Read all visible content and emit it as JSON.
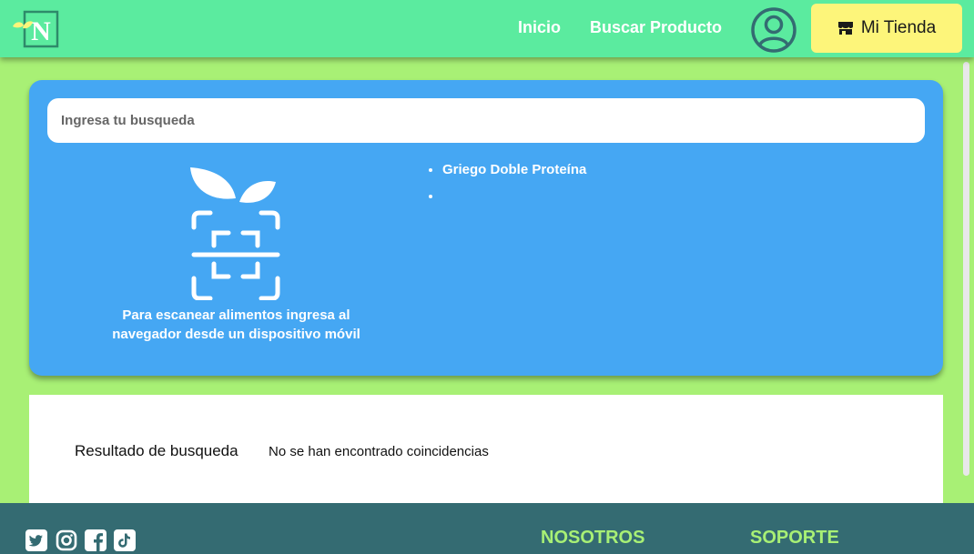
{
  "header": {
    "logo_letter": "N",
    "nav": {
      "home": "Inicio",
      "search_product": "Buscar Producto"
    },
    "store_button": "Mi Tienda"
  },
  "search": {
    "placeholder": "Ingresa tu busqueda",
    "value": "",
    "scan_message": "Para escanear alimentos ingresa al navegador desde un dispositivo móvil",
    "suggestions": [
      "Griego Doble Proteína",
      ""
    ]
  },
  "results": {
    "label": "Resultado de busqueda",
    "message": "No se han encontrado coincidencias"
  },
  "footer": {
    "social": [
      "twitter-icon",
      "instagram-icon",
      "facebook-icon",
      "tiktok-icon"
    ],
    "headings": {
      "about": "NOSOTROS",
      "support": "SOPORTE"
    }
  },
  "colors": {
    "page_bg": "#a8f075",
    "header_bg": "#5beb9f",
    "card_bg": "#45a7f3",
    "store_button_bg": "#fdf57a",
    "footer_bg": "#346b72",
    "footer_heading": "#a8f075",
    "user_icon": "#346b72"
  }
}
